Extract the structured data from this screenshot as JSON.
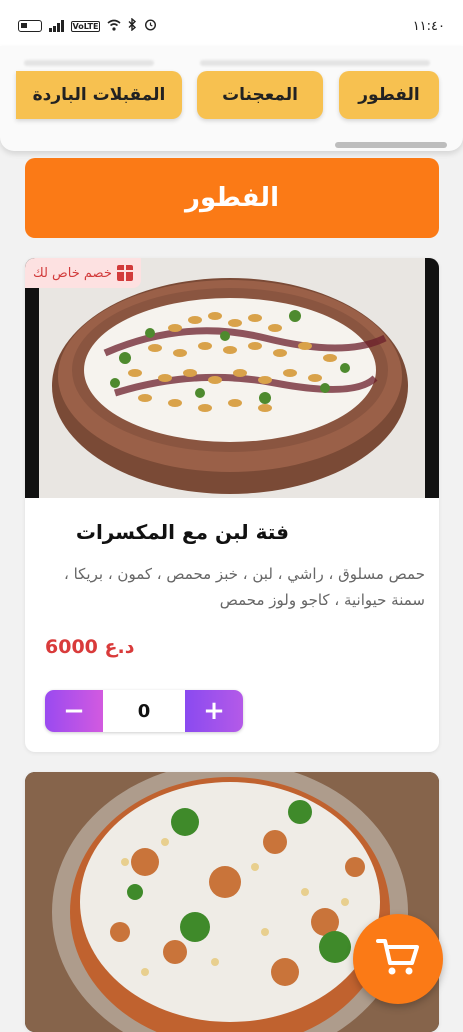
{
  "status_bar": {
    "time": "١١:٤٠",
    "icons": [
      "battery-icon",
      "signal-icon",
      "volte-icon",
      "wifi-icon",
      "bluetooth-icon",
      "alarm-icon"
    ],
    "volte_label": "VoLTE"
  },
  "categories": {
    "items": [
      {
        "label": "الفطور"
      },
      {
        "label": "المعجنات"
      },
      {
        "label": "المقبلات الباردة"
      }
    ],
    "accent": "#f7c150"
  },
  "section": {
    "title": "الفطور",
    "color": "#fb7a16"
  },
  "dishes": [
    {
      "badge": "خصم خاص لك",
      "badge_icon": "gift-icon",
      "name": "فتة لبن مع المكسرات",
      "description": "حمص مسلوق ، راشي ، لبن ، خبز محمص ، كمون ، بريكا ، سمنة حيوانية ، كاجو ولوز محمص",
      "price": "6000 د.ع",
      "quantity": "0",
      "minus_label": "−",
      "plus_label": "+"
    },
    {
      "badge": "",
      "name": "",
      "description": "",
      "price": ""
    }
  ],
  "cart": {
    "icon": "cart-icon",
    "color": "#fb7a16"
  }
}
